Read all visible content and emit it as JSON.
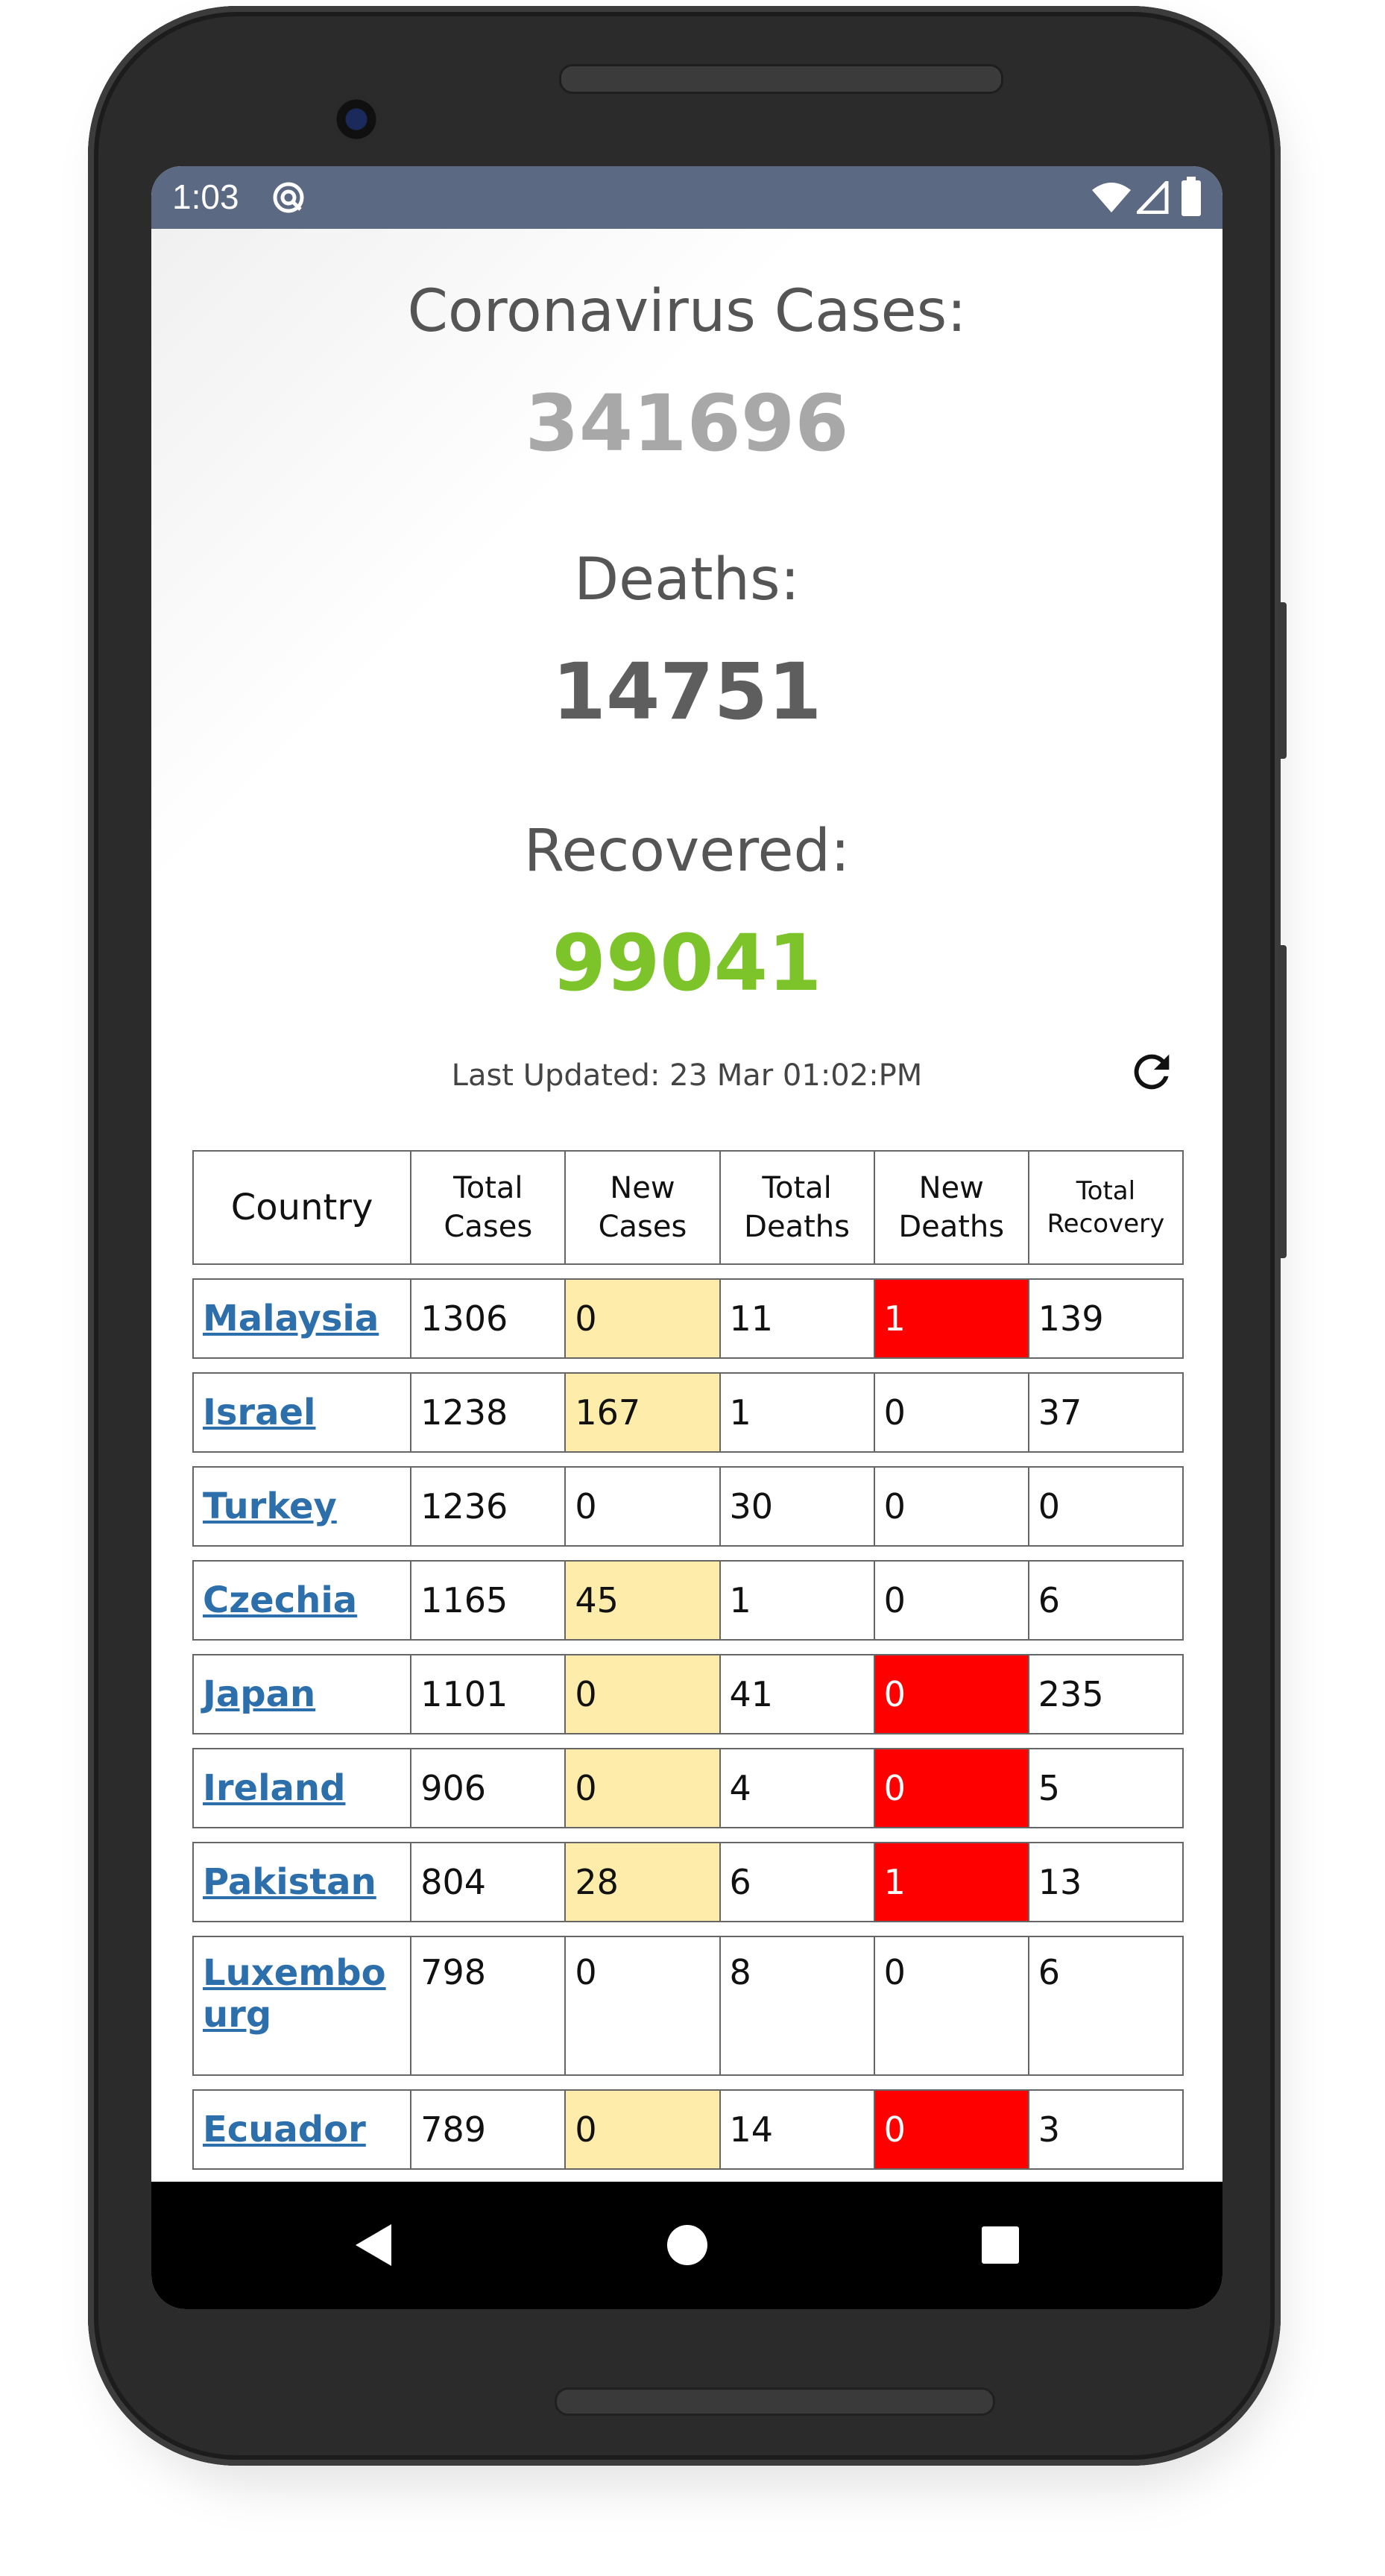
{
  "status_bar": {
    "time": "1:03"
  },
  "stats": {
    "cases_label": "Coronavirus Cases:",
    "cases_value": "341696",
    "deaths_label": "Deaths:",
    "deaths_value": "14751",
    "recovered_label": "Recovered:",
    "recovered_value": "99041",
    "last_updated": "Last Updated: 23 Mar 01:02:PM"
  },
  "colors": {
    "cases": "#a8a8a8",
    "deaths": "#5e5e5e",
    "recovered": "#7cc42a",
    "link": "#2d6fab",
    "new_cases_highlight": "#fdecaa",
    "new_deaths_highlight": "#ff0000"
  },
  "table": {
    "headers": {
      "country": "Country",
      "total_cases": [
        "Total",
        "Cases"
      ],
      "new_cases": [
        "New",
        "Cases"
      ],
      "total_deaths": [
        "Total",
        "Deaths"
      ],
      "new_deaths": [
        "New",
        "Deaths"
      ],
      "total_recovery": [
        "Total",
        "Recovery"
      ]
    },
    "rows": [
      {
        "country": "Malaysia",
        "total_cases": "1306",
        "new_cases": "0",
        "total_deaths": "11",
        "new_deaths": "1",
        "total_recovery": "139"
      },
      {
        "country": "Israel",
        "total_cases": "1238",
        "new_cases": "167",
        "total_deaths": "1",
        "new_deaths": "0",
        "total_recovery": "37"
      },
      {
        "country": "Turkey",
        "total_cases": "1236",
        "new_cases": "0",
        "total_deaths": "30",
        "new_deaths": "0",
        "total_recovery": "0"
      },
      {
        "country": "Czechia",
        "total_cases": "1165",
        "new_cases": "45",
        "total_deaths": "1",
        "new_deaths": "0",
        "total_recovery": "6"
      },
      {
        "country": "Japan",
        "total_cases": "1101",
        "new_cases": "0",
        "total_deaths": "41",
        "new_deaths": "0",
        "total_recovery": "235"
      },
      {
        "country": "Ireland",
        "total_cases": "906",
        "new_cases": "0",
        "total_deaths": "4",
        "new_deaths": "0",
        "total_recovery": "5"
      },
      {
        "country": "Pakistan",
        "total_cases": "804",
        "new_cases": "28",
        "total_deaths": "6",
        "new_deaths": "1",
        "total_recovery": "13"
      },
      {
        "country_line1": "Luxembo",
        "country_line2": "urg",
        "total_cases": "798",
        "new_cases": "0",
        "total_deaths": "8",
        "new_deaths": "0",
        "total_recovery": "6"
      },
      {
        "country": "Ecuador",
        "total_cases": "789",
        "new_cases": "0",
        "total_deaths": "14",
        "new_deaths": "0",
        "total_recovery": "3"
      }
    ]
  },
  "icons": {
    "status": [
      "app-notification-icon",
      "wifi-icon",
      "signal-icon",
      "battery-icon"
    ],
    "refresh": "refresh-icon",
    "nav": [
      "back-icon",
      "home-icon",
      "recents-icon"
    ]
  }
}
